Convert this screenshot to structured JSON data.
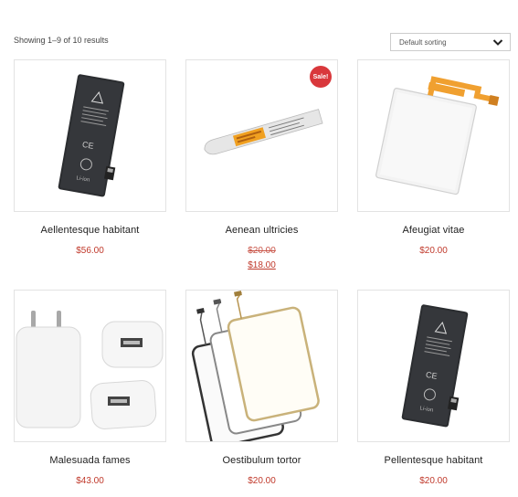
{
  "shop": {
    "result_count": "Showing 1–9 of 10 results",
    "sorting": {
      "selected": "Default sorting"
    }
  },
  "products": [
    {
      "name": "Aellentesque habitant",
      "price": "$56.00",
      "image": "battery-icon"
    },
    {
      "name": "Aenean ultricies",
      "old_price": "$20.00",
      "price": "$18.00",
      "sale_badge": "Sale!",
      "image": "pry-tool-icon"
    },
    {
      "name": "Afeugiat vitae",
      "price": "$20.00",
      "image": "battery-flex-icon"
    },
    {
      "name": "Malesuada fames",
      "price": "$43.00",
      "image": "charger-icon"
    },
    {
      "name": "Oestibulum tortor",
      "price": "$20.00",
      "image": "touch-screen-icon"
    },
    {
      "name": "Pellentesque habitant",
      "price": "$20.00",
      "image": "battery-icon"
    }
  ],
  "colors": {
    "price": "#c0392b",
    "sale_badge": "#d9383c",
    "border": "#e3e3e3"
  }
}
